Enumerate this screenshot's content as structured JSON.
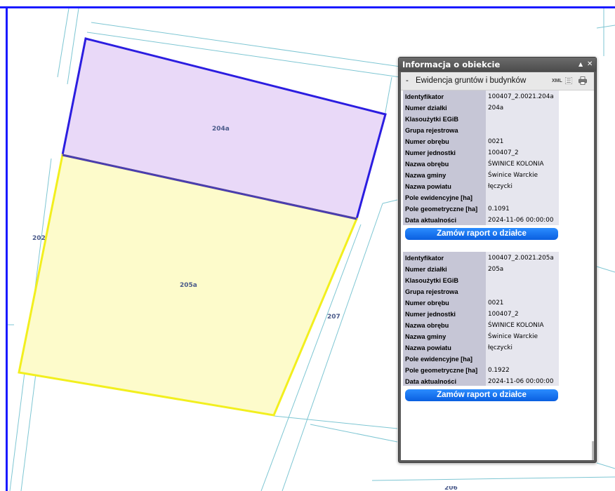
{
  "map": {
    "parcels": [
      {
        "label": "204a",
        "fill": "#e9d9f8",
        "stroke": "#2b1de0"
      },
      {
        "label": "205a",
        "fill": "#fdfbcb",
        "stroke": "#f2ef1e"
      }
    ],
    "labels": {
      "p202": "202",
      "p207": "207",
      "p206": "206",
      "p204a": "204a",
      "p205a": "205a"
    },
    "line_color": "#7ec6d3"
  },
  "panel": {
    "title": "Informacja o obiekcie",
    "collapse_icon": "▲",
    "close_icon": "✕",
    "section_toggle": "-",
    "section_title": "Ewidencja gruntów i budynków",
    "xml_label": "XML",
    "records": [
      {
        "rows": [
          {
            "label": "Identyfikator",
            "value": "100407_2.0021.204a"
          },
          {
            "label": "Numer działki",
            "value": "204a"
          },
          {
            "label": "Klasoużytki EGiB",
            "value": ""
          },
          {
            "label": "Grupa rejestrowa",
            "value": ""
          },
          {
            "label": "Numer obrębu",
            "value": "0021"
          },
          {
            "label": "Numer jednostki",
            "value": "100407_2"
          },
          {
            "label": "Nazwa obrębu",
            "value": "ŚWINICE KOLONIA"
          },
          {
            "label": "Nazwa gminy",
            "value": "Świnice Warckie"
          },
          {
            "label": "Nazwa powiatu",
            "value": "łęczycki"
          },
          {
            "label": "Pole ewidencyjne [ha]",
            "value": ""
          },
          {
            "label": "Pole geometryczne [ha]",
            "value": "0.1091"
          },
          {
            "label": "Data aktualności",
            "value": "2024-11-06 00:00:00"
          }
        ],
        "button": "Zamów raport o działce"
      },
      {
        "rows": [
          {
            "label": "Identyfikator",
            "value": "100407_2.0021.205a"
          },
          {
            "label": "Numer działki",
            "value": "205a"
          },
          {
            "label": "Klasoużytki EGiB",
            "value": ""
          },
          {
            "label": "Grupa rejestrowa",
            "value": ""
          },
          {
            "label": "Numer obrębu",
            "value": "0021"
          },
          {
            "label": "Numer jednostki",
            "value": "100407_2"
          },
          {
            "label": "Nazwa obrębu",
            "value": "ŚWINICE KOLONIA"
          },
          {
            "label": "Nazwa gminy",
            "value": "Świnice Warckie"
          },
          {
            "label": "Nazwa powiatu",
            "value": "łęczycki"
          },
          {
            "label": "Pole ewidencyjne [ha]",
            "value": ""
          },
          {
            "label": "Pole geometryczne [ha]",
            "value": "0.1922"
          },
          {
            "label": "Data aktualności",
            "value": "2024-11-06 00:00:00"
          }
        ],
        "button": "Zamów raport o działce"
      }
    ]
  }
}
